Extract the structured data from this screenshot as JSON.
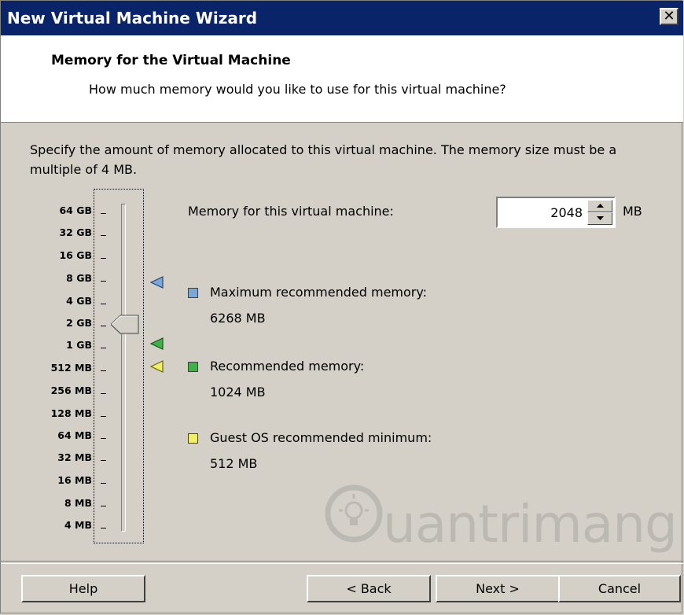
{
  "window": {
    "title": "New Virtual Machine Wizard",
    "close_glyph": "✕"
  },
  "header": {
    "title": "Memory for the Virtual Machine",
    "subtitle": "How much memory would you like to use for this virtual machine?"
  },
  "description": "Specify the amount of memory allocated to this virtual machine. The memory size must be a multiple of 4 MB.",
  "slider": {
    "labels": [
      "64 GB",
      "32 GB",
      "16 GB",
      "8 GB",
      "4 GB",
      "2 GB",
      "1 GB",
      "512 MB",
      "256 MB",
      "128 MB",
      "64 MB",
      "32 MB",
      "16 MB",
      "8 MB",
      "4 MB"
    ],
    "selected": "2 GB"
  },
  "memory": {
    "label": "Memory for this virtual machine:",
    "value": "2048",
    "unit": "MB"
  },
  "recommendations": [
    {
      "label": "Maximum recommended memory:",
      "value": "6268 MB",
      "color": "#7aa7d6"
    },
    {
      "label": "Recommended memory:",
      "value": "1024 MB",
      "color": "#3fb04a"
    },
    {
      "label": "Guest OS recommended minimum:",
      "value": "512 MB",
      "color": "#f0ef6a"
    }
  ],
  "watermark": {
    "text": "uantrimang"
  },
  "buttons": {
    "help": "Help",
    "back": "< Back",
    "next": "Next >",
    "cancel": "Cancel"
  }
}
